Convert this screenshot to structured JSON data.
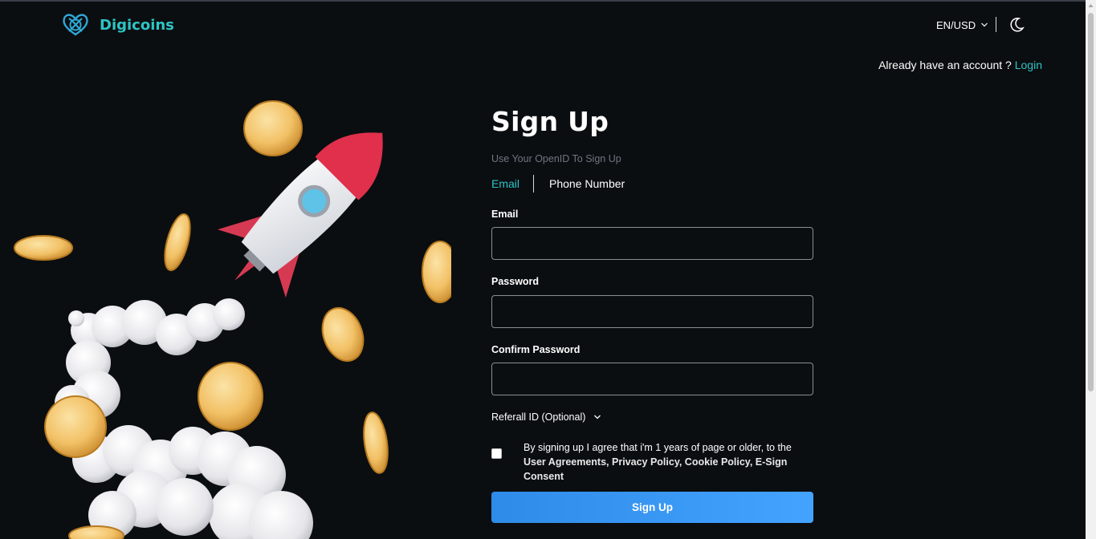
{
  "header": {
    "brand": "Digicoins",
    "language_currency": "EN/USD",
    "icons": {
      "logo": "digicoins-logo-icon",
      "lang_chevron": "chevron-down-icon",
      "theme": "moon-icon"
    }
  },
  "account": {
    "prompt": "Already have an account ?",
    "login_label": "Login"
  },
  "form": {
    "title": "Sign Up",
    "subtitle": "Use Your OpenID To Sign Up",
    "tabs": [
      {
        "label": "Email",
        "active": true
      },
      {
        "label": "Phone Number",
        "active": false
      }
    ],
    "email_label": "Email",
    "email_value": "",
    "password_label": "Password",
    "password_value": "",
    "confirm_label": "Confirm Password",
    "confirm_value": "",
    "referral_label": "Referall ID (Optional)",
    "agreement_text": "By signing up I agree that i'm 1 years of page or older, to the",
    "agreement_links": "User Agreements, Privacy Policy, Cookie Policy, E-Sign Consent",
    "agreement_checked": false,
    "submit_label": "Sign Up"
  },
  "colors": {
    "background": "#0b0e11",
    "accent": "#2ec4c4",
    "button_start": "#2f8be8",
    "button_end": "#43a3ff",
    "muted": "#6f7680"
  }
}
